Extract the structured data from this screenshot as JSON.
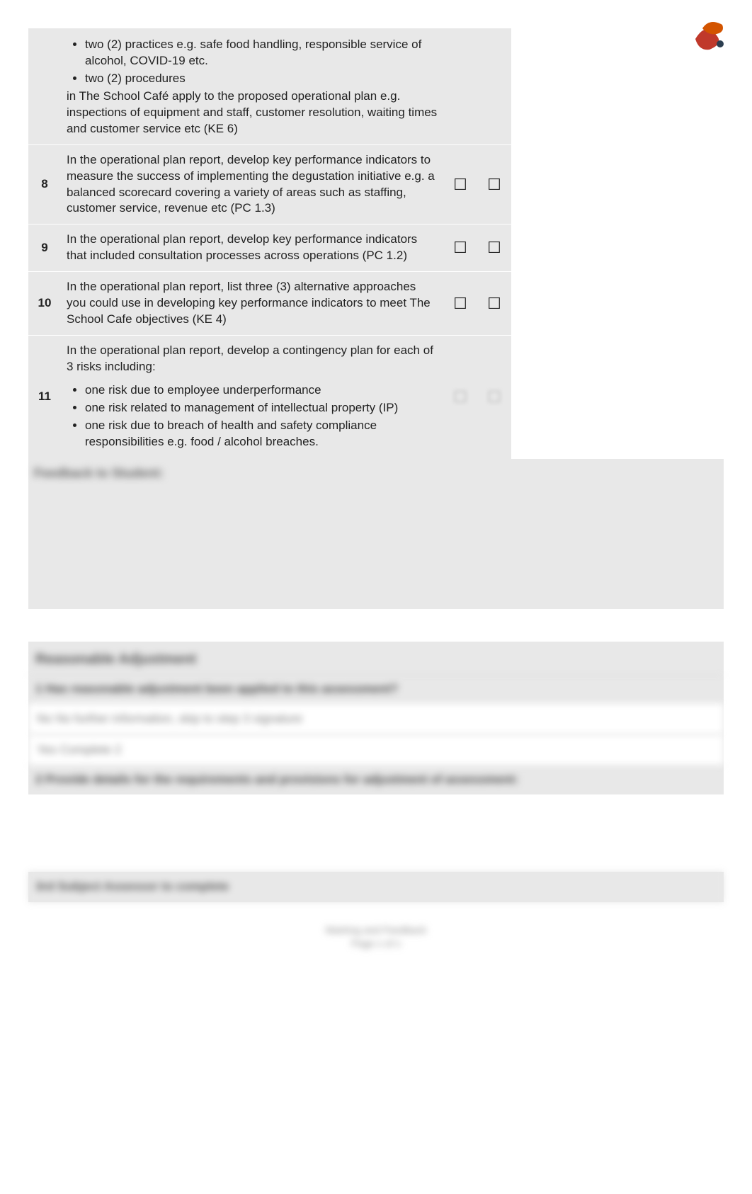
{
  "logo_name": "logo-icon",
  "rows": {
    "r7": {
      "bullet1": "two (2) practices e.g. safe food handling, responsible service of alcohol, COVID-19 etc.",
      "bullet2": "two (2) procedures",
      "tail": "in The School Café apply to the proposed operational plan e.g. inspections of equipment and staff, customer resolution, waiting times and customer service etc (KE 6)"
    },
    "r8": {
      "num": "8",
      "desc": "In the operational plan report, develop key performance indicators to measure the success of implementing the degustation initiative e.g. a balanced scorecard covering a variety of areas such as staffing, customer service, revenue etc (PC 1.3)",
      "chk1": "☐",
      "chk2": "☐"
    },
    "r9": {
      "num": "9",
      "desc": "In the operational plan report, develop key performance indicators that included consultation processes across operations (PC 1.2)",
      "chk1": "☐",
      "chk2": "☐"
    },
    "r10": {
      "num": "10",
      "desc": "In the operational plan report, list three (3) alternative approaches you could use in developing key performance indicators to meet The School Cafe objectives (KE 4)",
      "chk1": "☐",
      "chk2": "☐"
    },
    "r11": {
      "num": "11",
      "intro": "In the operational plan report, develop a contingency plan for each of 3 risks including:",
      "b1": "one risk due to employee underperformance",
      "b2": "one risk related to management of intellectual property (IP)",
      "b3": "one risk due to breach of health and safety compliance responsibilities e.g. food / alcohol breaches.",
      "chk1": "☐",
      "chk2": "☐"
    }
  },
  "feedback_label": "Feedback to Student:",
  "section2": {
    "heading": "Reasonable Adjustment",
    "q1": "1   Has reasonable adjustment been applied to this assessment?",
    "opt_no": "No    No further information, skip to step 3 signature",
    "opt_yes": "Yes   Complete 2",
    "q2": "2   Provide details for the requirements and provisions for adjustment of assessment:",
    "sub_heading": "3rd Subject Assessor to complete"
  },
  "footer": {
    "line1": "Marking and Feedback",
    "line2": "Page x of x"
  }
}
